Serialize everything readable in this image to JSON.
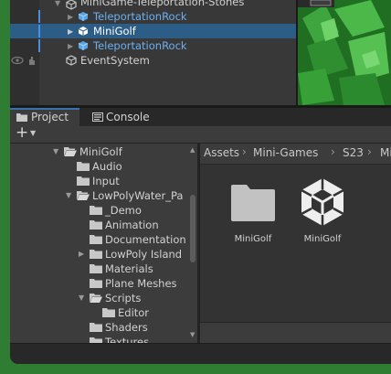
{
  "hierarchy": {
    "items": [
      {
        "label": "MiniGame-Teleportation-Stones",
        "style": "normal"
      },
      {
        "label": "TeleportationRock",
        "style": "prefab"
      },
      {
        "label": "MiniGolf",
        "style": "selected"
      },
      {
        "label": "TeleportationRock",
        "style": "prefab"
      },
      {
        "label": "EventSystem",
        "style": "normal"
      }
    ]
  },
  "tabs": [
    {
      "label": "Project",
      "icon": "folder-icon",
      "active": true
    },
    {
      "label": "Console",
      "icon": "console-icon",
      "active": false
    }
  ],
  "toolbar": {
    "add_label": "+",
    "add_icon": "plus-icon"
  },
  "project_tree": [
    {
      "label": "MiniGolf",
      "depth": 0,
      "expanded": true
    },
    {
      "label": "Audio",
      "depth": 1
    },
    {
      "label": "Input",
      "depth": 1
    },
    {
      "label": "LowPolyWater_Pa",
      "depth": 1,
      "expanded": true
    },
    {
      "label": "_Demo",
      "depth": 2
    },
    {
      "label": "Animation",
      "depth": 2
    },
    {
      "label": "Documentation",
      "depth": 2
    },
    {
      "label": "LowPoly Island",
      "depth": 2,
      "collapsed": true
    },
    {
      "label": "Materials",
      "depth": 2
    },
    {
      "label": "Plane Meshes",
      "depth": 2
    },
    {
      "label": "Scripts",
      "depth": 2,
      "expanded": true
    },
    {
      "label": "Editor",
      "depth": 3
    },
    {
      "label": "Shaders",
      "depth": 2
    },
    {
      "label": "Textures",
      "depth": 2
    }
  ],
  "breadcrumb": [
    "Assets",
    "Mini-Games",
    "S23",
    "Mini"
  ],
  "assets": [
    {
      "label": "MiniGolf",
      "icon": "folder-icon"
    },
    {
      "label": "MiniGolf",
      "icon": "unity-scene-icon"
    }
  ],
  "colors": {
    "accent": "#2c5d87",
    "prefab_text": "#6ab0f3",
    "panel": "#3c3c3c"
  }
}
